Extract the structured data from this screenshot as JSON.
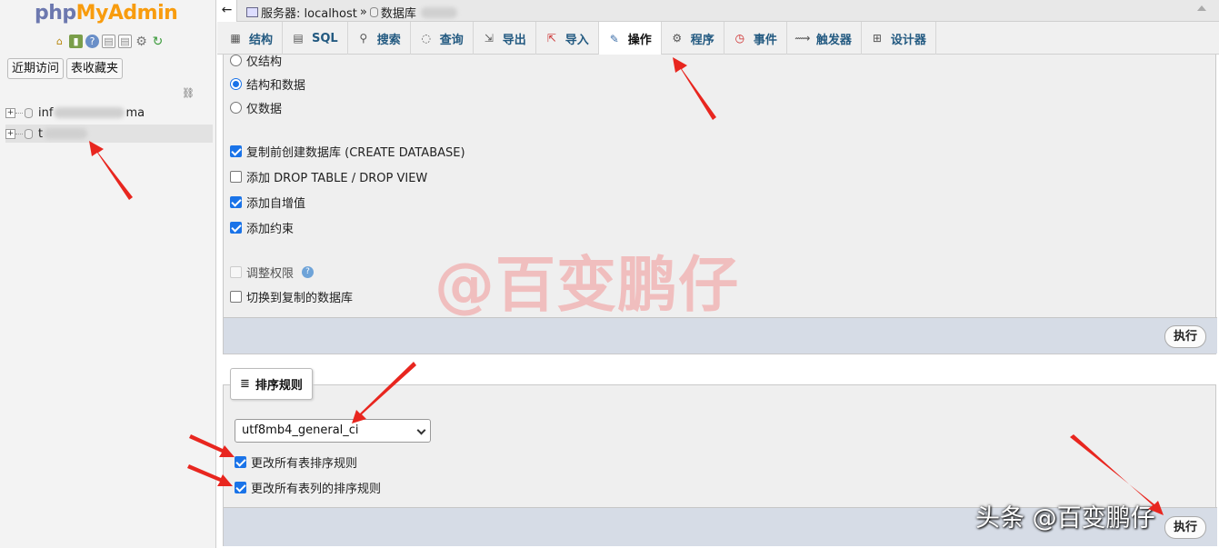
{
  "logo": {
    "php": "php",
    "myadmin": "MyAdmin"
  },
  "nav": {
    "icons": [
      "home-icon",
      "exit-icon",
      "help-icon",
      "docs-icon",
      "docs-icon",
      "gear-icon",
      "reload-icon"
    ],
    "recent_label": "近期访问",
    "favorites_label": "表收藏夹",
    "databases": [
      {
        "name_prefix": "inf",
        "name_suffix": "ma"
      },
      {
        "name_prefix": "t"
      }
    ]
  },
  "breadcrumb": {
    "server": "服务器: localhost",
    "separator": "»",
    "db": "数据库"
  },
  "tabs": [
    {
      "label": "结构",
      "icon": "structure-icon"
    },
    {
      "label": "SQL",
      "icon": "sql-icon"
    },
    {
      "label": "搜索",
      "icon": "search-icon"
    },
    {
      "label": "查询",
      "icon": "query-icon"
    },
    {
      "label": "导出",
      "icon": "export-icon"
    },
    {
      "label": "导入",
      "icon": "import-icon"
    },
    {
      "label": "操作",
      "icon": "wrench-icon",
      "active": true
    },
    {
      "label": "程序",
      "icon": "routines-icon"
    },
    {
      "label": "事件",
      "icon": "clock-icon"
    },
    {
      "label": "触发器",
      "icon": "trigger-icon"
    },
    {
      "label": "设计器",
      "icon": "designer-icon"
    }
  ],
  "copy": {
    "radios": [
      {
        "label": "仅结构",
        "checked": false
      },
      {
        "label": "结构和数据",
        "checked": true
      },
      {
        "label": "仅数据",
        "checked": false
      }
    ],
    "checks": [
      {
        "label": "复制前创建数据库 (CREATE DATABASE)",
        "checked": true
      },
      {
        "label": "添加 DROP TABLE / DROP VIEW",
        "checked": false
      },
      {
        "label": "添加自增值",
        "checked": true
      },
      {
        "label": "添加约束",
        "checked": true
      }
    ],
    "adjust_privileges": {
      "label": "调整权限",
      "checked": false,
      "disabled": true
    },
    "switch_db": {
      "label": "切换到复制的数据库",
      "checked": false
    },
    "execute_label": "执行"
  },
  "collation": {
    "legend": "排序规则",
    "selected": "utf8mb4_general_ci",
    "change_tables": {
      "label": "更改所有表排序规则",
      "checked": true
    },
    "change_columns": {
      "label": "更改所有表列的排序规则",
      "checked": true
    },
    "execute_label": "执行"
  },
  "watermarks": {
    "center": "@百变鹏仔",
    "corner": "头条 @百变鹏仔"
  },
  "colors": {
    "arrow": "#e8261f",
    "accent": "#1a73e8",
    "tab_text": "#235a81"
  }
}
